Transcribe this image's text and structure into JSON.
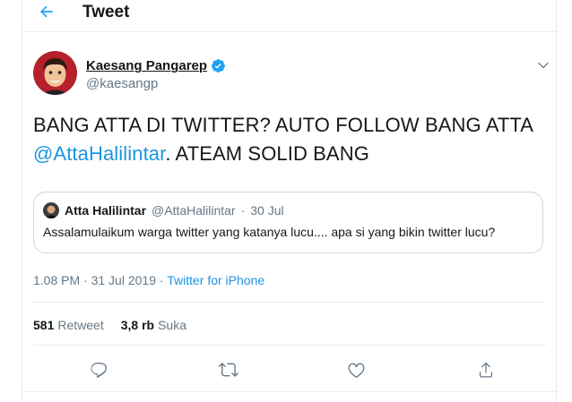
{
  "header": {
    "title": "Tweet"
  },
  "tweet": {
    "author_name": "Kaesang Pangarep",
    "author_handle": "@kaesangp",
    "text_part1": "BANG ATTA DI TWITTER? AUTO FOLLOW BANG ATTA",
    "mention": "@AttaHalilintar",
    "text_part2": ". ATEAM SOLID BANG",
    "time": "1.08 PM",
    "dot": " · ",
    "date": "31 Jul 2019",
    "source": "Twitter for iPhone"
  },
  "quote": {
    "name": "Atta Halilintar",
    "handle": "@AttaHalilintar",
    "dot": "·",
    "date": "30 Jul",
    "text": "Assalamulaikum warga twitter yang katanya lucu.... apa si yang bikin twitter lucu?"
  },
  "stats": {
    "retweet_count": "581",
    "retweet_label": "Retweet",
    "like_count": "3,8 rb",
    "like_label": "Suka"
  },
  "colors": {
    "accent": "#1da1f2",
    "link": "#1b95e0",
    "secondary_text": "#657786",
    "border": "#e6ecf0"
  },
  "icons": [
    "back-arrow-icon",
    "verified-badge-icon",
    "chevron-down-icon",
    "reply-icon",
    "retweet-icon",
    "like-icon",
    "share-icon"
  ]
}
